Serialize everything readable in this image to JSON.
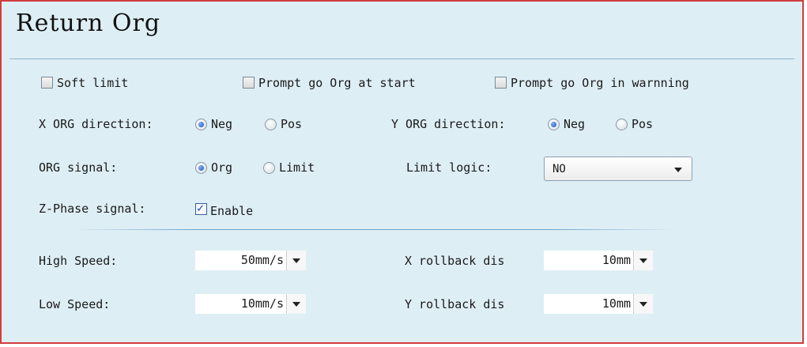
{
  "title": "Return Org",
  "checkboxes": {
    "soft_limit": {
      "label": "Soft limit",
      "checked": false
    },
    "prompt_start": {
      "label": "Prompt go Org at start",
      "checked": false
    },
    "prompt_warning": {
      "label": "Prompt go Org in warnning",
      "checked": false
    }
  },
  "x_org_direction": {
    "label": "X ORG direction:",
    "options": [
      "Neg",
      "Pos"
    ],
    "selected": "Neg"
  },
  "y_org_direction": {
    "label": "Y ORG direction:",
    "options": [
      "Neg",
      "Pos"
    ],
    "selected": "Neg"
  },
  "org_signal": {
    "label": "ORG signal:",
    "options": [
      "Org",
      "Limit"
    ],
    "selected": "Org"
  },
  "limit_logic": {
    "label": "Limit logic:",
    "value": "NO"
  },
  "z_phase": {
    "label": "Z-Phase signal:",
    "checkbox_label": "Enable",
    "checked": true
  },
  "high_speed": {
    "label": "High Speed:",
    "value": "50mm/s"
  },
  "low_speed": {
    "label": "Low Speed:",
    "value": "10mm/s"
  },
  "x_rollback": {
    "label": "X rollback dis",
    "value": "10mm"
  },
  "y_rollback": {
    "label": "Y rollback dis",
    "value": "10mm"
  }
}
